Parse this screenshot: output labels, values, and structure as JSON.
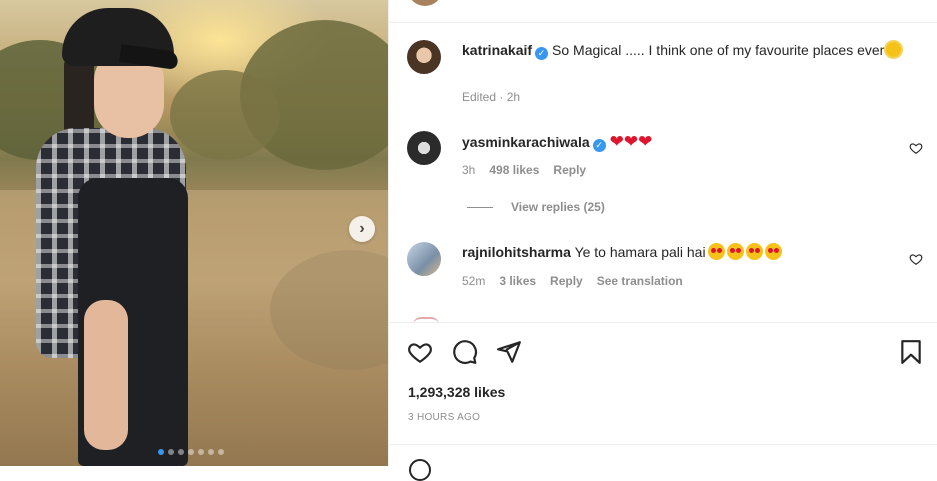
{
  "post": {
    "caption": {
      "username": "katrinakaif",
      "text": "So Magical ..... I think one of my favourite places ever",
      "emoji": "sun",
      "meta": "Edited · 2h"
    },
    "comments": [
      {
        "username": "yasminkarachiwala",
        "text": "",
        "emojis": [
          "heart",
          "heart",
          "heart"
        ],
        "time": "3h",
        "likes": "498 likes",
        "reply": "Reply"
      },
      {
        "username": "rajnilohitsharma",
        "text": "Ye to hamara pali hai",
        "emojis": [
          "star-struck",
          "star-struck",
          "star-struck",
          "star-struck"
        ],
        "time": "52m",
        "likes": "3 likes",
        "reply": "Reply",
        "translation": "See translation"
      }
    ],
    "view_replies": "View replies (25)",
    "likes_total": "1,293,328 likes",
    "posted": "3 HOURS AGO"
  },
  "colors": {
    "verified": "#3897f0",
    "muted_text": "#8e8e8e",
    "primary_text": "#262626"
  },
  "icons": [
    "heart-icon",
    "comment-icon",
    "share-icon",
    "bookmark-icon",
    "chevron-right-icon",
    "verified-badge-icon"
  ]
}
